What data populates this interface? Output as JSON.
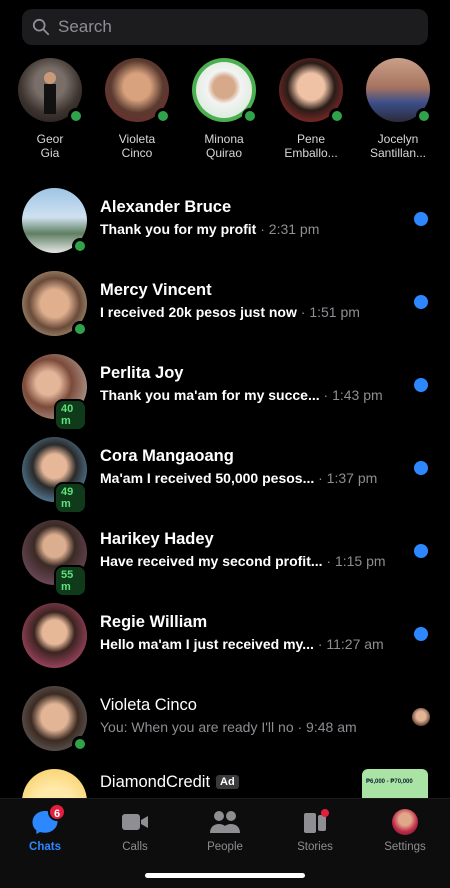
{
  "search": {
    "placeholder": "Search"
  },
  "stories": [
    {
      "line1": "Geor",
      "line2": "Gia"
    },
    {
      "line1": "Violeta",
      "line2": "Cinco"
    },
    {
      "line1": "Minona",
      "line2": "Quirao"
    },
    {
      "line1": "Pene",
      "line2": "Emballo..."
    },
    {
      "line1": "Jocelyn",
      "line2": "Santillan..."
    }
  ],
  "chats": [
    {
      "name": "Alexander Bruce",
      "message": "Thank you for my profit",
      "time": "· 2:31 pm",
      "unread": true,
      "active_badge": ""
    },
    {
      "name": "Mercy Vincent",
      "message": "I received 20k pesos just now",
      "time": "· 1:51 pm",
      "unread": true,
      "active_badge": ""
    },
    {
      "name": "Perlita Joy",
      "message": "Thank you ma'am for my succe...",
      "time": "· 1:43 pm",
      "unread": true,
      "active_badge": "40 m"
    },
    {
      "name": "Cora Mangaoang",
      "message": "Ma'am I received 50,000 pesos...",
      "time": "· 1:37 pm",
      "unread": true,
      "active_badge": "49 m"
    },
    {
      "name": "Harikey Hadey",
      "message": "Have received my second profit...",
      "time": "· 1:15 pm",
      "unread": true,
      "active_badge": "55 m"
    },
    {
      "name": "Regie William",
      "message": "Hello ma'am I just received my...",
      "time": "· 11:27 am",
      "unread": true,
      "active_badge": ""
    },
    {
      "name": "Violeta Cinco",
      "message": "You: When you are ready I'll no",
      "time": "· 9:48 am",
      "unread": false,
      "active_badge": ""
    }
  ],
  "ad": {
    "name": "DiamondCredit",
    "badge": "Ad",
    "thumb_text": "₱6,000 - ₱70,000"
  },
  "tabs": [
    {
      "label": "Chats",
      "badge": "6",
      "icon": "chat-bubble-icon"
    },
    {
      "label": "Calls",
      "icon": "video-camera-icon"
    },
    {
      "label": "People",
      "icon": "people-icon"
    },
    {
      "label": "Stories",
      "icon": "stories-icon"
    },
    {
      "label": "Settings",
      "icon": "profile-avatar-icon"
    }
  ],
  "colors": {
    "accent": "#2d88ff",
    "online": "#31a24c",
    "badge": "#e41e3f",
    "background": "#000000"
  }
}
